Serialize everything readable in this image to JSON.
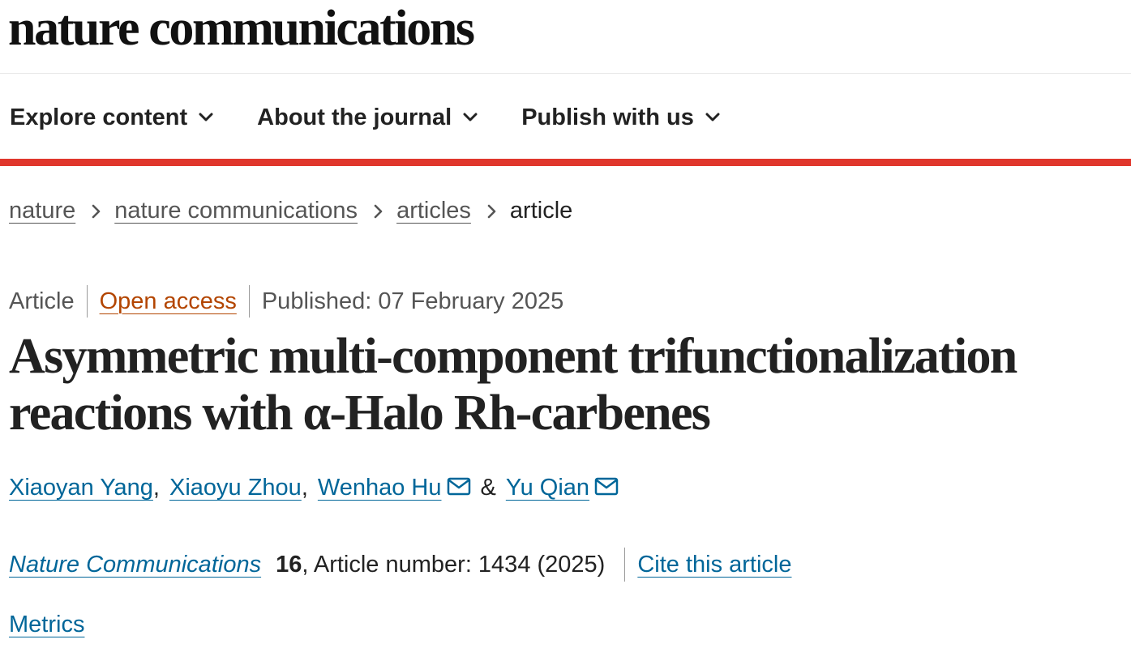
{
  "header": {
    "logo_text": "nature communications"
  },
  "nav": {
    "items": [
      {
        "label": "Explore content",
        "icon": "chevron-down-icon"
      },
      {
        "label": "About the journal",
        "icon": "chevron-down-icon"
      },
      {
        "label": "Publish with us",
        "icon": "chevron-down-icon"
      }
    ]
  },
  "colors": {
    "accent_bar": "#e0362c",
    "link": "#006699",
    "open_access": "#b34500"
  },
  "breadcrumb": {
    "items": [
      "nature",
      "nature communications",
      "articles"
    ],
    "current": "article"
  },
  "article_meta": {
    "type": "Article",
    "access": "Open access",
    "published": "Published: 07 February 2025"
  },
  "article": {
    "title": "Asymmetric multi-component trifunctionalization reactions with α-Halo Rh-carbenes",
    "authors": [
      {
        "name": "Xiaoyan Yang",
        "suffix": ",",
        "email_icon": false
      },
      {
        "name": "Xiaoyu Zhou",
        "suffix": ",",
        "email_icon": false
      },
      {
        "name": "Wenhao Hu",
        "suffix": "",
        "email_icon": true
      },
      {
        "name": "Yu Qian",
        "suffix": "",
        "email_icon": true
      }
    ],
    "author_join": "&"
  },
  "citation": {
    "journal": "Nature Communications",
    "volume": "16",
    "details": ", Article number: 1434 (2025)",
    "cite_label": "Cite this article"
  },
  "metrics": {
    "label": "Metrics"
  }
}
